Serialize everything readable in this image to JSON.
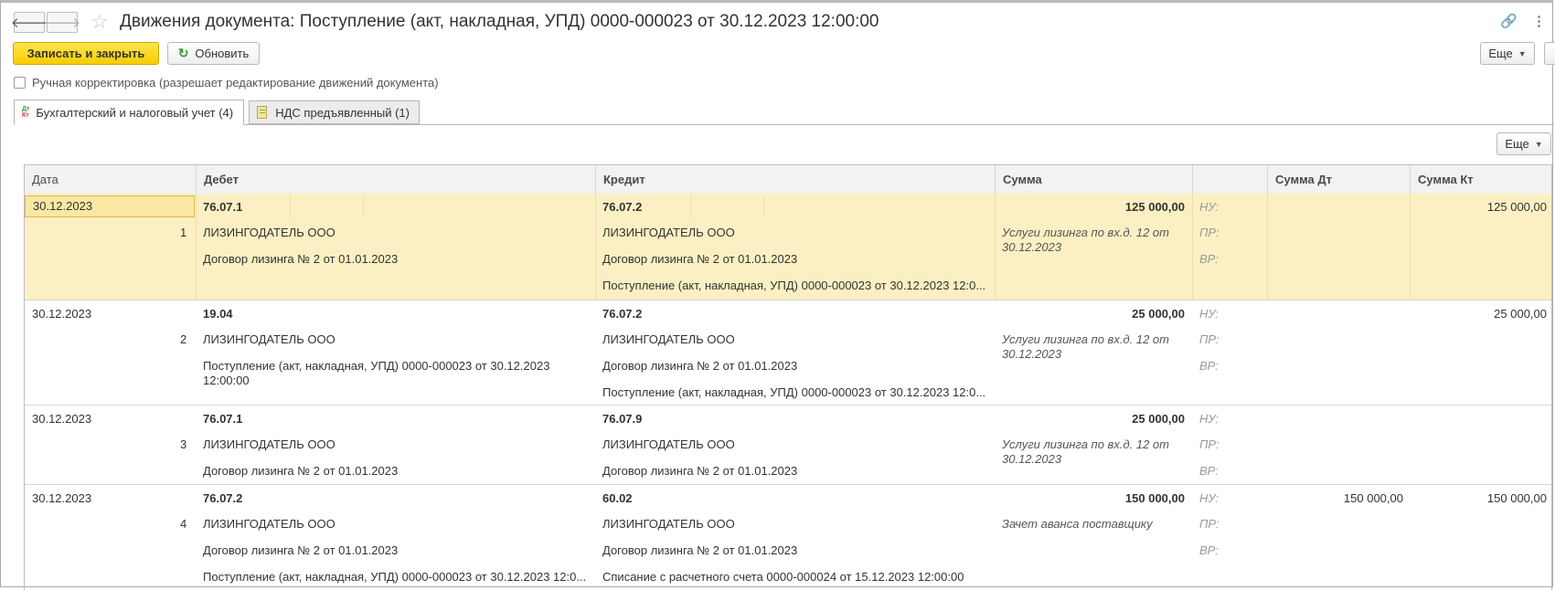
{
  "window": {
    "title": "Движения документа: Поступление (акт, накладная, УПД) 0000-000023 от 30.12.2023 12:00:00",
    "back_icon": "arrow-left",
    "forward_icon": "arrow-right",
    "favorite_icon": "star",
    "link_icon": "link",
    "menu_icon": "more-vertical"
  },
  "toolbar": {
    "save_close_label": "Записать и закрыть",
    "refresh_label": "Обновить",
    "more_label": "Еще"
  },
  "manual_edit": {
    "label": "Ручная корректировка (разрешает редактирование движений документа)",
    "checked": false
  },
  "tabs": [
    {
      "label": "Бухгалтерский и налоговый учет (4)",
      "icon_top": "Дт",
      "icon_bottom": "Кт",
      "active": true
    },
    {
      "label": "НДС предъявленный (1)",
      "active": false
    }
  ],
  "table_toolbar": {
    "more_label": "Еще"
  },
  "table": {
    "columns": [
      "Дата",
      "Дебет",
      "Кредит",
      "Сумма",
      "",
      "Сумма Дт",
      "Сумма Кт"
    ],
    "labels": {
      "nu": "НУ:",
      "pr": "ПР:",
      "vr": "ВР:"
    },
    "rows": [
      {
        "date": "30.12.2023",
        "num": "1",
        "debit": [
          "76.07.1",
          "ЛИЗИНГОДАТЕЛЬ ООО",
          "Договор лизинга № 2 от 01.01.2023"
        ],
        "credit": [
          "76.07.2",
          "ЛИЗИНГОДАТЕЛЬ ООО",
          "Договор лизинга № 2 от 01.01.2023",
          "Поступление (акт, накладная, УПД) 0000-000023 от 30.12.2023 12:0..."
        ],
        "sum": "125 000,00",
        "content": "Услуги лизинга по вх.д. 12 от 30.12.2023",
        "sum_dt": "",
        "sum_kt": "125 000,00"
      },
      {
        "date": "30.12.2023",
        "num": "2",
        "debit": [
          "19.04",
          "ЛИЗИНГОДАТЕЛЬ ООО",
          "Поступление (акт, накладная, УПД) 0000-000023 от 30.12.2023 12:00:00"
        ],
        "credit": [
          "76.07.2",
          "ЛИЗИНГОДАТЕЛЬ ООО",
          "Договор лизинга № 2 от 01.01.2023",
          "Поступление (акт, накладная, УПД) 0000-000023 от 30.12.2023 12:0..."
        ],
        "sum": "25 000,00",
        "content": "Услуги лизинга по вх.д. 12 от 30.12.2023",
        "sum_dt": "",
        "sum_kt": "25 000,00"
      },
      {
        "date": "30.12.2023",
        "num": "3",
        "debit": [
          "76.07.1",
          "ЛИЗИНГОДАТЕЛЬ ООО",
          "Договор лизинга № 2 от 01.01.2023"
        ],
        "credit": [
          "76.07.9",
          "ЛИЗИНГОДАТЕЛЬ ООО",
          "Договор лизинга № 2 от 01.01.2023"
        ],
        "sum": "25 000,00",
        "content": "Услуги лизинга по вх.д. 12 от 30.12.2023",
        "sum_dt": "",
        "sum_kt": ""
      },
      {
        "date": "30.12.2023",
        "num": "4",
        "debit": [
          "76.07.2",
          "ЛИЗИНГОДАТЕЛЬ ООО",
          "Договор лизинга № 2 от 01.01.2023",
          "Поступление (акт, накладная, УПД) 0000-000023 от 30.12.2023 12:0..."
        ],
        "credit": [
          "60.02",
          "ЛИЗИНГОДАТЕЛЬ ООО",
          "Договор лизинга № 2 от 01.01.2023",
          "Списание с расчетного счета 0000-000024 от 15.12.2023 12:00:00"
        ],
        "sum": "150 000,00",
        "content": "Зачет аванса поставщику",
        "sum_dt": "150 000,00",
        "sum_kt": "150 000,00"
      }
    ]
  }
}
